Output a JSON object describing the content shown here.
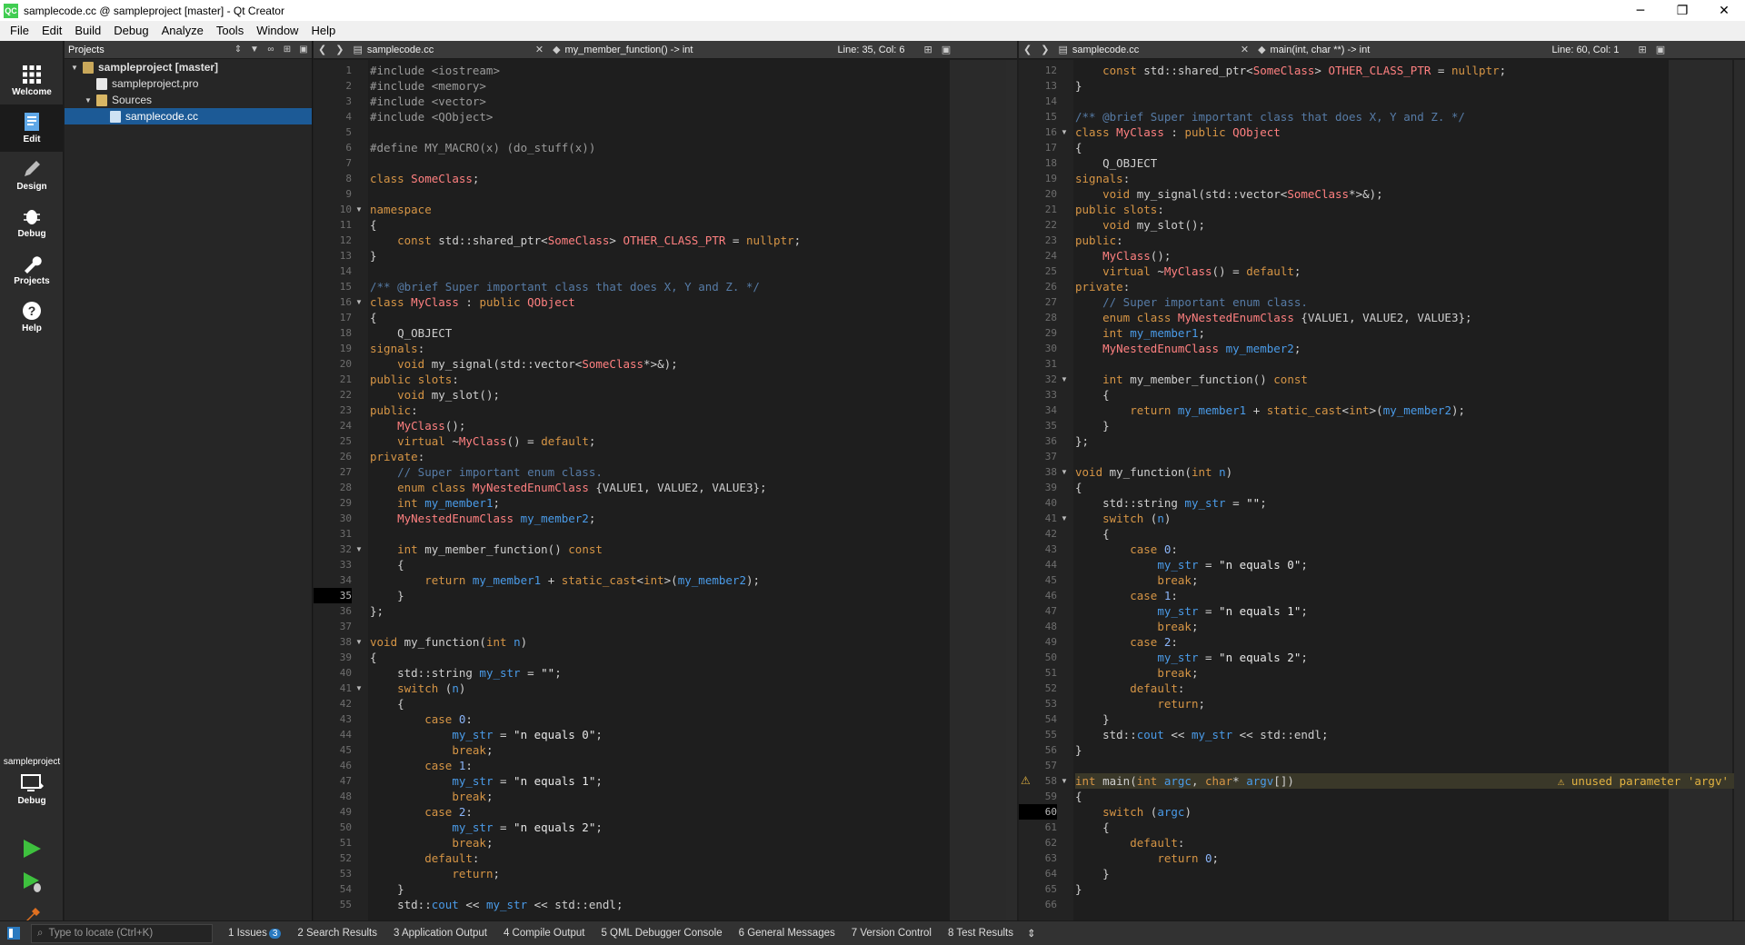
{
  "title": "samplecode.cc @ sampleproject [master] - Qt Creator",
  "window_controls": {
    "minimize": "─",
    "maximize": "❐",
    "close": "✕"
  },
  "menu": [
    "File",
    "Edit",
    "Build",
    "Debug",
    "Analyze",
    "Tools",
    "Window",
    "Help"
  ],
  "modes": [
    "Welcome",
    "Edit",
    "Design",
    "Debug",
    "Projects",
    "Help"
  ],
  "kit": {
    "project": "sampleproject",
    "mode": "Debug"
  },
  "projects_panel": {
    "header": "Projects",
    "tree": [
      {
        "label": "sampleproject [master]",
        "depth": 0,
        "icon": "projf",
        "arrow": "▼",
        "bold": true
      },
      {
        "label": "sampleproject.pro",
        "depth": 1,
        "icon": "file",
        "arrow": ""
      },
      {
        "label": "Sources",
        "depth": 1,
        "icon": "folder",
        "arrow": "▼"
      },
      {
        "label": "samplecode.cc",
        "depth": 2,
        "icon": "cc",
        "arrow": "",
        "selected": true
      }
    ]
  },
  "left_editor": {
    "file": "samplecode.cc",
    "symbol": "my_member_function() -> int",
    "position": "Line: 35, Col: 6",
    "first_line": 1,
    "current_line": 35
  },
  "right_editor": {
    "file": "samplecode.cc",
    "symbol": "main(int, char **) -> int",
    "position": "Line: 60, Col: 1",
    "first_line": 12,
    "current_line": 60
  },
  "warning": {
    "line": 58,
    "text": "unused parameter 'argv'"
  },
  "folds": [
    10,
    16,
    32,
    38,
    41,
    58
  ],
  "code_lines": [
    "#include <iostream>",
    "#include <memory>",
    "#include <vector>",
    "#include <QObject>",
    "",
    "#define MY_MACRO(x) (do_stuff(x))",
    "",
    "class SomeClass;",
    "",
    "namespace",
    "{",
    "    const std::shared_ptr<SomeClass> OTHER_CLASS_PTR = nullptr;",
    "}",
    "",
    "/** @brief Super important class that does X, Y and Z. */",
    "class MyClass : public QObject",
    "{",
    "    Q_OBJECT",
    "signals:",
    "    void my_signal(std::vector<SomeClass*>&);",
    "public slots:",
    "    void my_slot();",
    "public:",
    "    MyClass();",
    "    virtual ~MyClass() = default;",
    "private:",
    "    // Super important enum class.",
    "    enum class MyNestedEnumClass {VALUE1, VALUE2, VALUE3};",
    "    int my_member1;",
    "    MyNestedEnumClass my_member2;",
    "",
    "    int my_member_function() const",
    "    {",
    "        return my_member1 + static_cast<int>(my_member2);",
    "    }",
    "};",
    "",
    "void my_function(int n)",
    "{",
    "    std::string my_str = \"\";",
    "    switch (n)",
    "    {",
    "        case 0:",
    "            my_str = \"n equals 0\";",
    "            break;",
    "        case 1:",
    "            my_str = \"n equals 1\";",
    "            break;",
    "        case 2:",
    "            my_str = \"n equals 2\";",
    "            break;",
    "        default:",
    "            return;",
    "    }",
    "    std::cout << my_str << std::endl;",
    "}",
    "",
    "int main(int argc, char* argv[])",
    "{",
    "    switch (argc)",
    "    {",
    "        default:",
    "            return 0;",
    "    }",
    "}",
    ""
  ],
  "locator_placeholder": "Type to locate (Ctrl+K)",
  "output_panes": [
    {
      "num": "1",
      "label": "Issues",
      "badge": "3"
    },
    {
      "num": "2",
      "label": "Search Results"
    },
    {
      "num": "3",
      "label": "Application Output"
    },
    {
      "num": "4",
      "label": "Compile Output"
    },
    {
      "num": "5",
      "label": "QML Debugger Console"
    },
    {
      "num": "6",
      "label": "General Messages"
    },
    {
      "num": "7",
      "label": "Version Control"
    },
    {
      "num": "8",
      "label": "Test Results"
    }
  ]
}
